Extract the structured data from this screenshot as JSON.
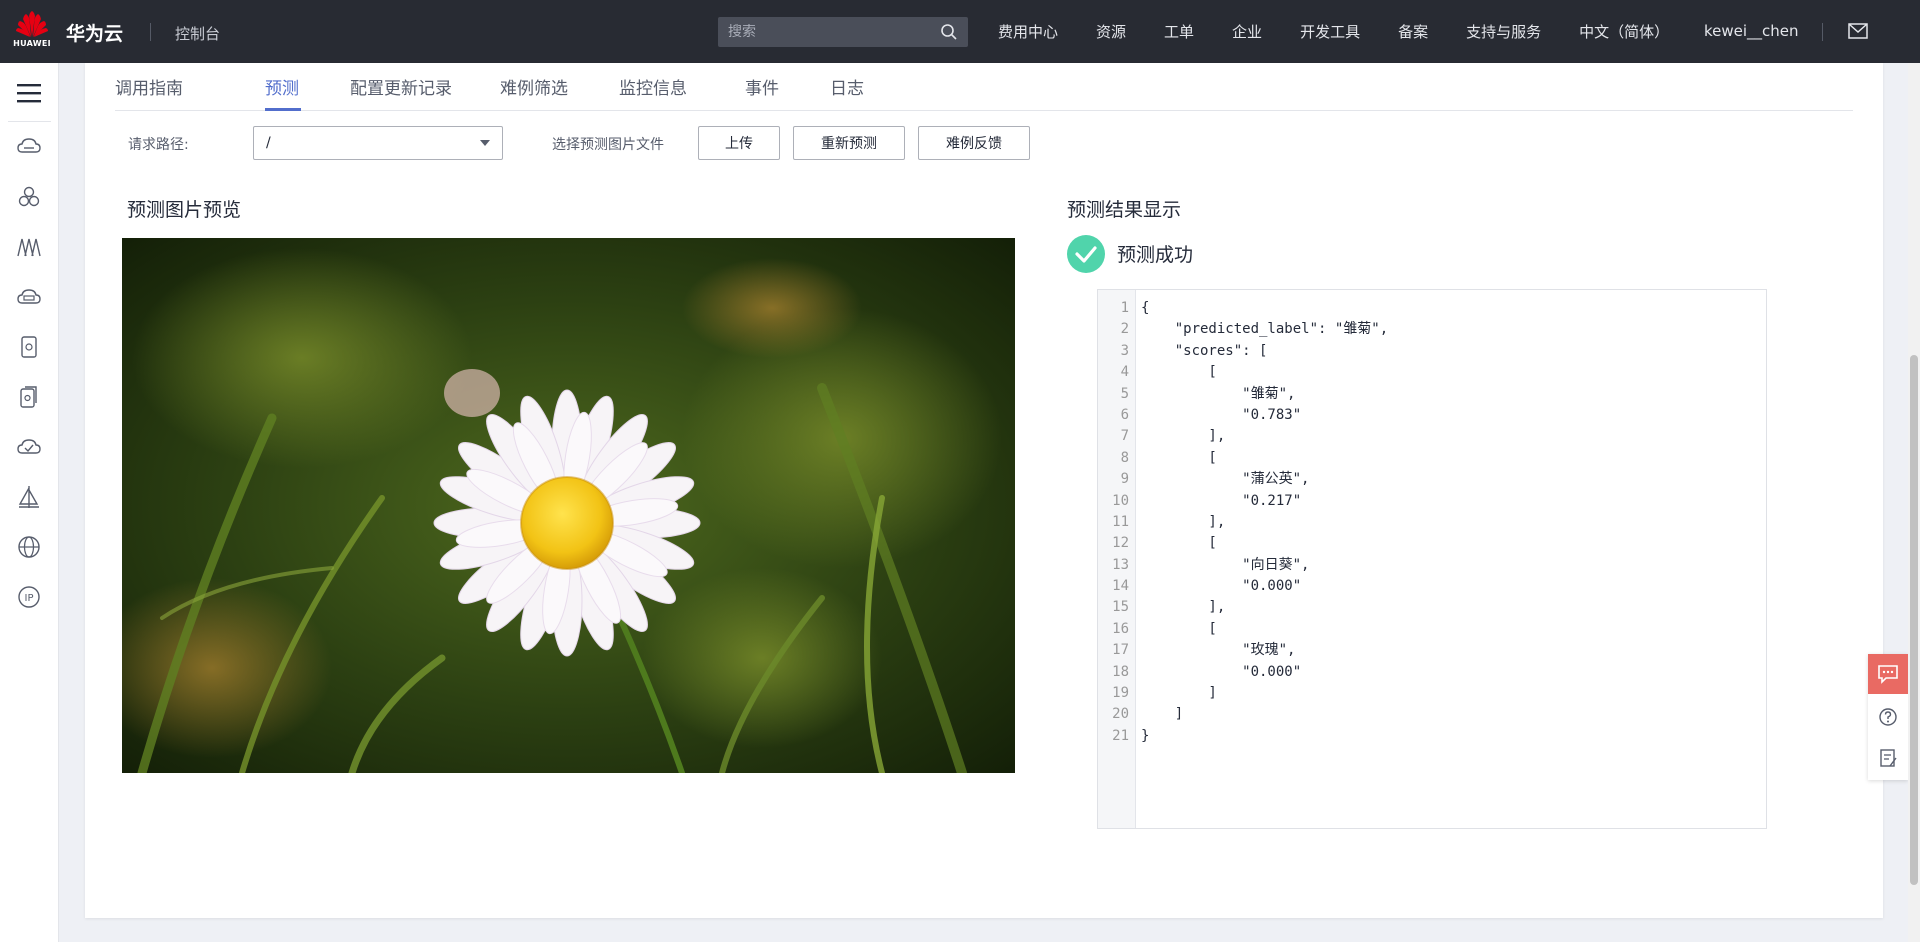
{
  "header": {
    "logo_text": "HUAWEI",
    "brand": "华为云",
    "console": "控制台",
    "search_placeholder": "搜索",
    "nav": [
      "费用中心",
      "资源",
      "工单",
      "企业",
      "开发工具",
      "备案",
      "支持与服务",
      "中文（简体）"
    ],
    "username": "kewei__chen"
  },
  "tabs": [
    "调用指南",
    "预测",
    "配置更新记录",
    "难例筛选",
    "监控信息",
    "事件",
    "日志"
  ],
  "active_tab": "预测",
  "toolbar": {
    "request_path_label": "请求路径:",
    "request_path_value": "/",
    "file_label": "选择预测图片文件",
    "upload_button": "上传",
    "repredict_button": "重新预测",
    "hard_case_button": "难例反馈"
  },
  "preview": {
    "title": "预测图片预览"
  },
  "result": {
    "title": "预测结果显示",
    "status": "预测成功",
    "lines": [
      "{",
      "    \"predicted_label\": \"雏菊\",",
      "    \"scores\": [",
      "        [",
      "            \"雏菊\",",
      "            \"0.783\"",
      "        ],",
      "        [",
      "            \"蒲公英\",",
      "            \"0.217\"",
      "        ],",
      "        [",
      "            \"向日葵\",",
      "            \"0.000\"",
      "        ],",
      "        [",
      "            \"玫瑰\",",
      "            \"0.000\"",
      "        ]",
      "    ]",
      "}"
    ]
  },
  "colors": {
    "topbar": "#282b33",
    "accent": "#526ecc",
    "success": "#50d4ab",
    "chat": "#e96a63"
  },
  "icons": {
    "sidebar": [
      "menu-icon",
      "cloud-server-icon",
      "cluster-icon",
      "network-icon",
      "cloud-storage-icon",
      "database-icon",
      "rds-icon",
      "cloud-sync-icon",
      "ai-icon",
      "globe-icon",
      "ip-icon"
    ],
    "float": [
      "chat-icon",
      "help-icon",
      "feedback-icon"
    ]
  }
}
